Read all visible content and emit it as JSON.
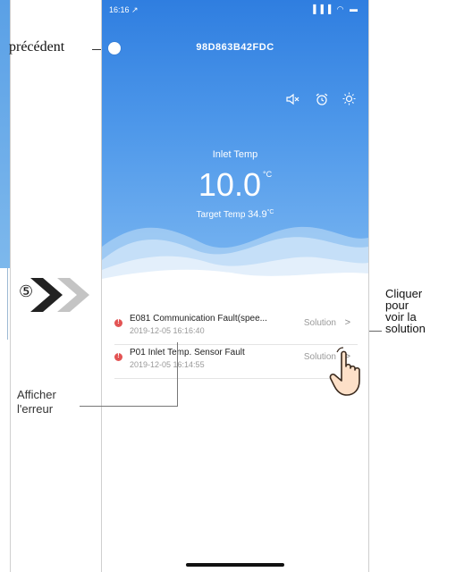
{
  "status": {
    "time": "16:16 ↗",
    "icons": "▐▐▐ ◠ ▬"
  },
  "app": {
    "device_title": "98D863B42FDC",
    "icons": [
      "mute-icon",
      "alarm-icon",
      "sun-icon"
    ]
  },
  "temperature": {
    "label": "Inlet Temp",
    "value": "10.0",
    "unit": "°C",
    "target_label": "Target Temp",
    "target_value": "34.9",
    "target_unit": "°C"
  },
  "faults": [
    {
      "title": "E081 Communication Fault(spee...",
      "time": "2019-12-05 16:16:40",
      "action": "Solution",
      "chevron": ">"
    },
    {
      "title": "P01 Inlet Temp. Sensor Fault",
      "time": "2019-12-05 16:14:55",
      "action": "Solution",
      "chevron": ">"
    }
  ],
  "annotations": {
    "back_label": "précédent",
    "solution_label": [
      "Cliquer",
      "pour",
      "voir la",
      "solution"
    ],
    "error_label": [
      "Afficher",
      "l'erreur"
    ],
    "step_number": "⑤"
  },
  "colors": {
    "header_top": "#2f7ee0",
    "header_bottom": "#7cb7f1",
    "fault_red": "#e35454",
    "chevron_dark": "#222222",
    "chevron_light": "#c4c4c4",
    "hand_fill": "#fde0c8"
  }
}
